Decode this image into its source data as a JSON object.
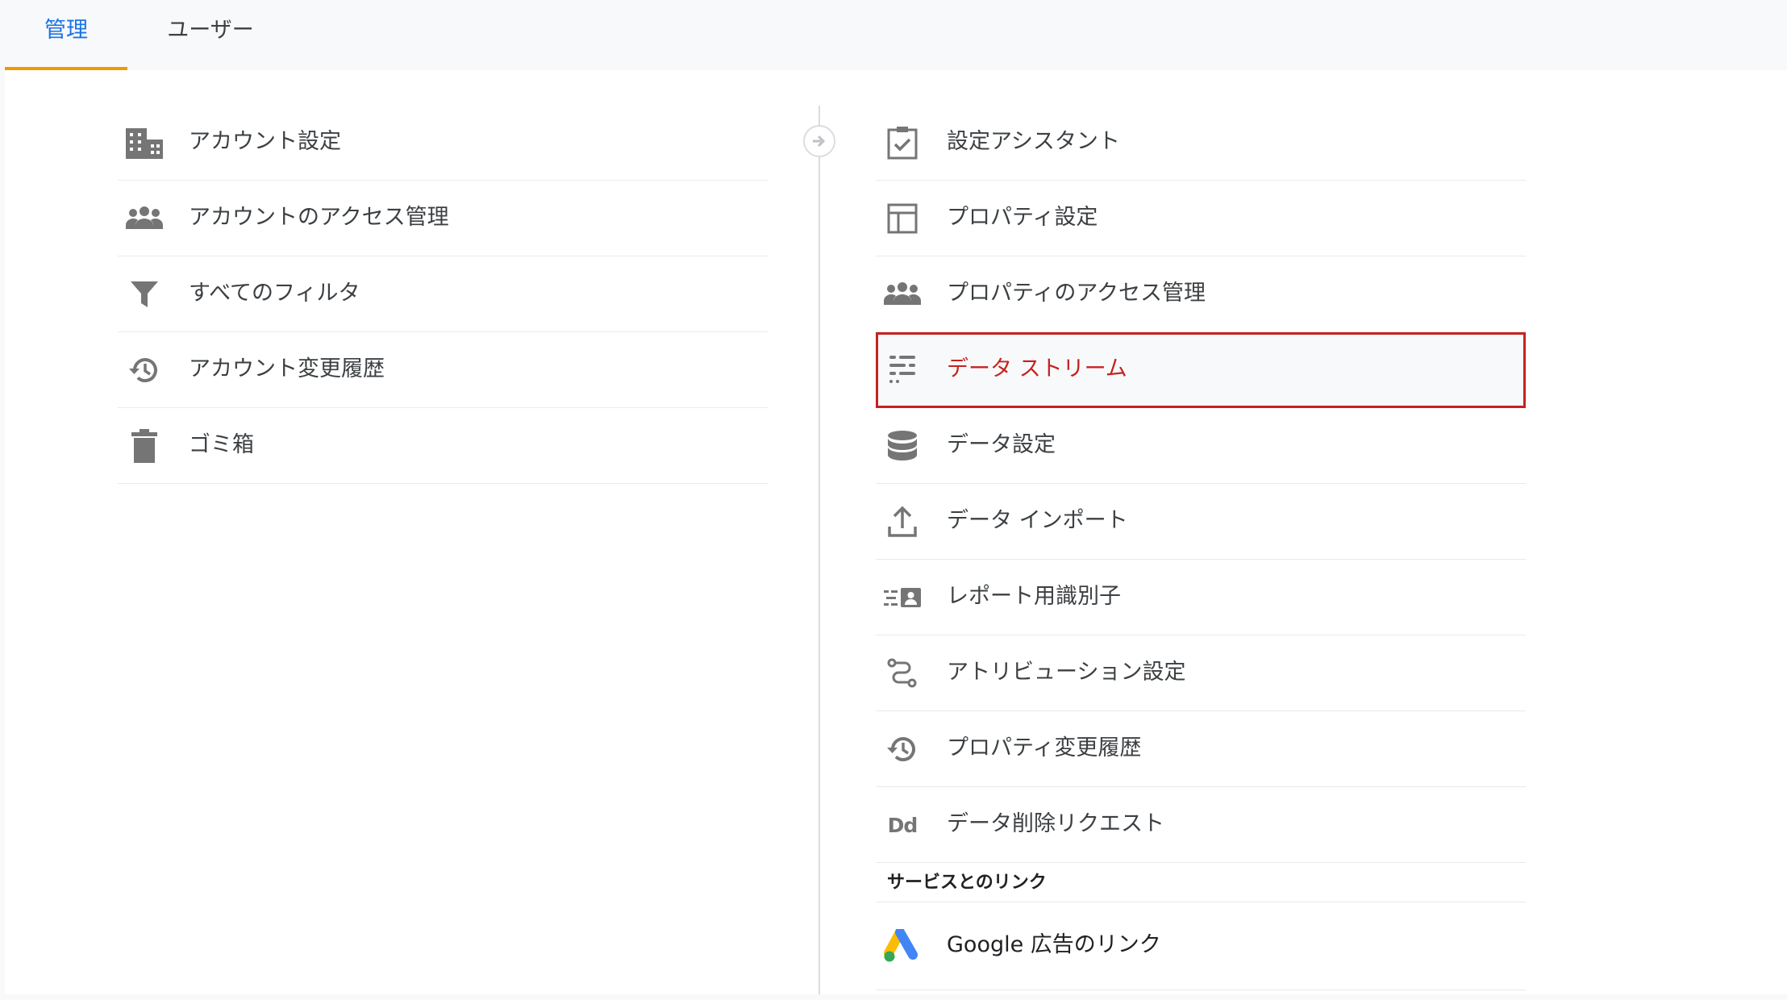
{
  "tabs": [
    {
      "label": "管理",
      "active": true
    },
    {
      "label": "ユーザー",
      "active": false
    }
  ],
  "account_column": {
    "items": [
      {
        "label": "アカウント設定",
        "icon": "building-icon"
      },
      {
        "label": "アカウントのアクセス管理",
        "icon": "people-icon"
      },
      {
        "label": "すべてのフィルタ",
        "icon": "filter-icon"
      },
      {
        "label": "アカウント変更履歴",
        "icon": "history-icon"
      },
      {
        "label": "ゴミ箱",
        "icon": "trash-icon"
      }
    ]
  },
  "property_column": {
    "items": [
      {
        "label": "設定アシスタント",
        "icon": "checklist-icon"
      },
      {
        "label": "プロパティ設定",
        "icon": "property-layout-icon"
      },
      {
        "label": "プロパティのアクセス管理",
        "icon": "people-icon"
      },
      {
        "label": "データ ストリーム",
        "icon": "data-stream-icon",
        "highlighted": true
      },
      {
        "label": "データ設定",
        "icon": "database-icon"
      },
      {
        "label": "データ インポート",
        "icon": "upload-icon"
      },
      {
        "label": "レポート用識別子",
        "icon": "reporting-identity-icon"
      },
      {
        "label": "アトリビューション設定",
        "icon": "attribution-icon"
      },
      {
        "label": "プロパティ変更履歴",
        "icon": "history-icon"
      },
      {
        "label": "データ削除リクエスト",
        "icon": "dd-icon",
        "icon_text": "Dd"
      }
    ],
    "section_header": "サービスとのリンク",
    "links": [
      {
        "label": "Google 広告のリンク",
        "icon": "google-ads-icon"
      }
    ]
  },
  "colors": {
    "active_tab_text": "#1a73e8",
    "active_tab_underline": "#f29900",
    "highlight_border": "#c5221f",
    "icon_gray": "#757575"
  }
}
